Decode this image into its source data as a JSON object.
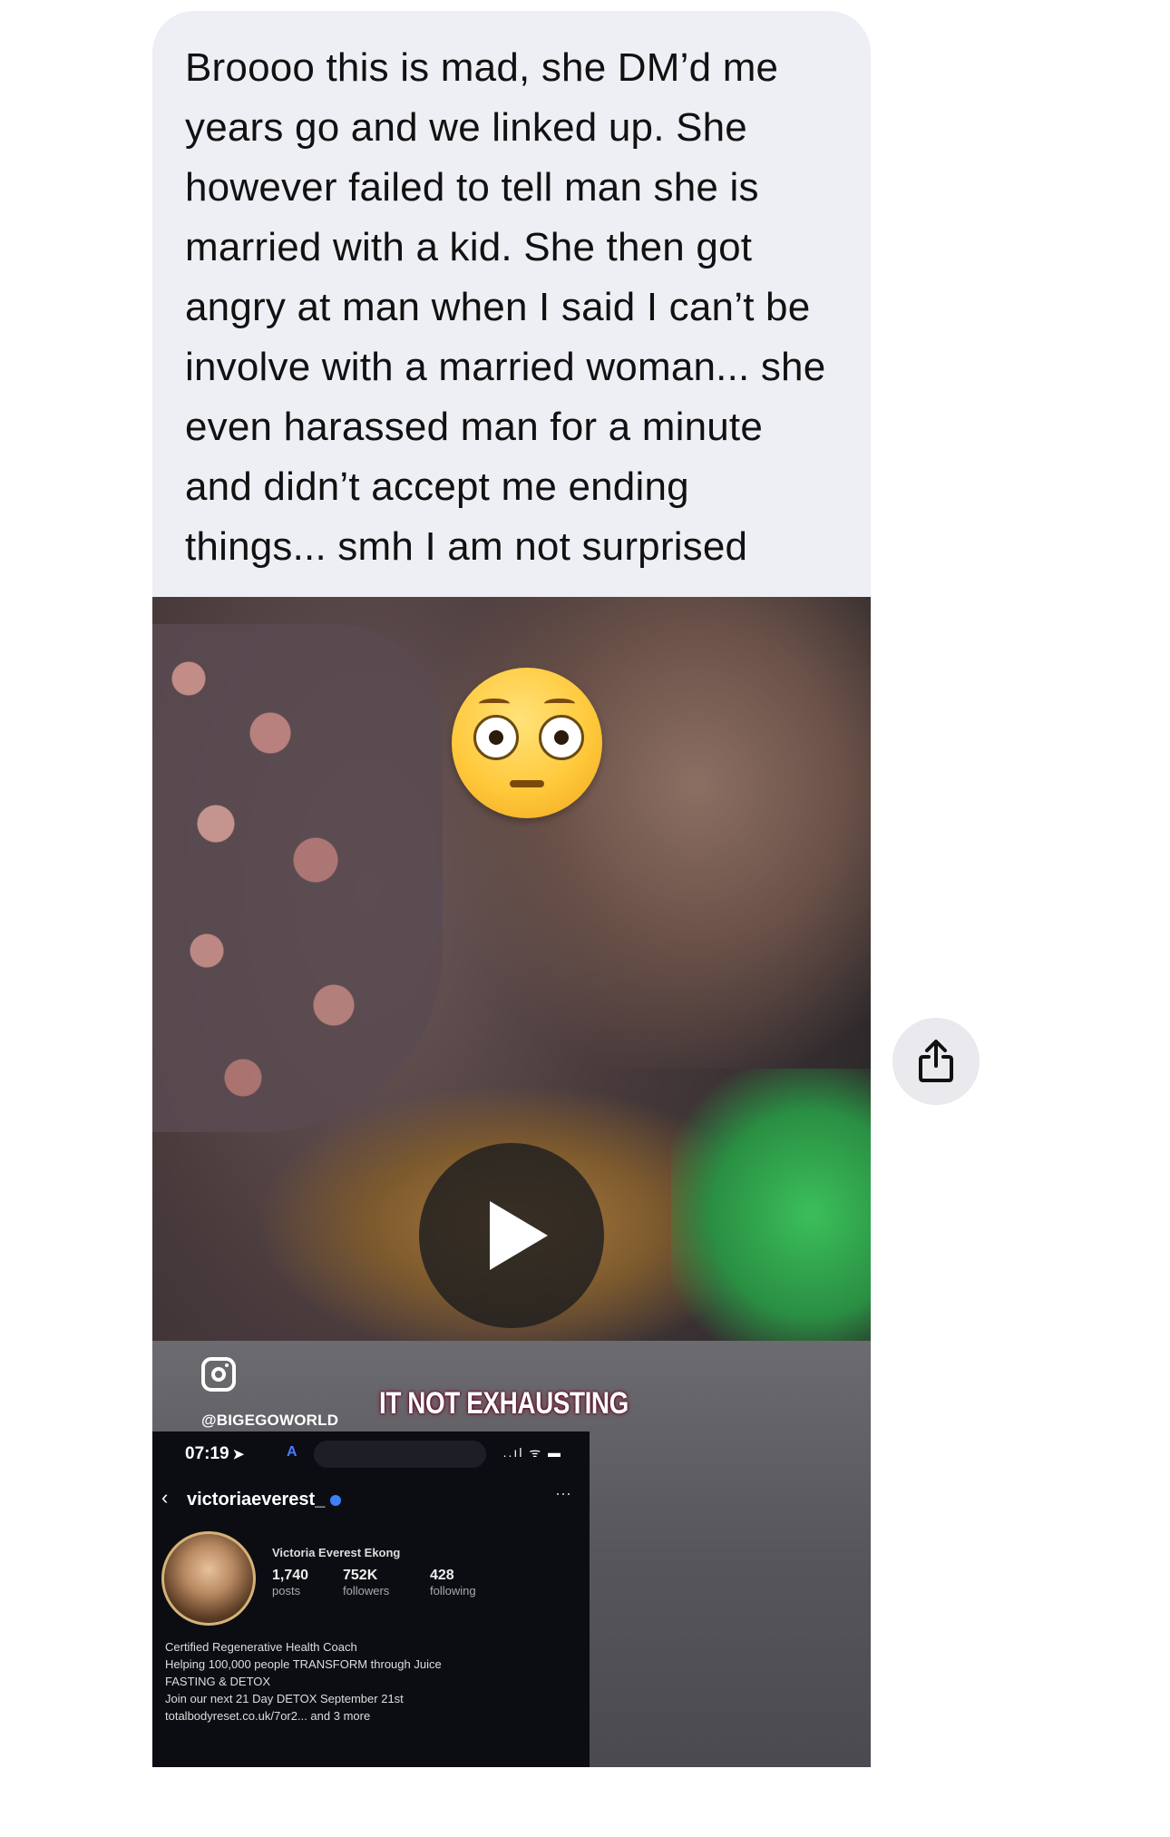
{
  "message": {
    "text": "Broooo this is mad, she DM’d me years go and we linked up. She however failed to tell man she is married with a kid. She then got angry at man when I said I can’t be involve with a married woman... she even harassed man for a minute and didn’t accept me ending things... smh I am not surprised"
  },
  "video": {
    "emoji": "flushed-face-emoji",
    "watermark_handle": "@BIGEGOWORLD",
    "caption": "IT NOT EXHAUSTING",
    "play_icon": "play-icon",
    "inset": {
      "time": "07:19",
      "location_arrow": "➤",
      "indicator": "A",
      "signal": "..ıl ᯤ ▬",
      "back": "‹",
      "username": "victoriaeverest_",
      "more": "···",
      "full_name": "Victoria Everest Ekong",
      "stats": [
        {
          "num": "1,740",
          "label": "posts"
        },
        {
          "num": "752K",
          "label": "followers"
        },
        {
          "num": "428",
          "label": "following"
        }
      ],
      "bio": [
        "Certified Regenerative Health Coach",
        "Helping 100,000 people TRANSFORM through Juice",
        "FASTING & DETOX",
        "Join our next 21 Day DETOX September 21st",
        "totalbodyreset.co.uk/7or2... and 3 more"
      ]
    }
  },
  "share": {
    "icon": "share-icon"
  },
  "colors": {
    "bubble_bg": "#eeeff4",
    "share_bg": "#e9e9ee",
    "caption_glow": "#b0003a"
  }
}
